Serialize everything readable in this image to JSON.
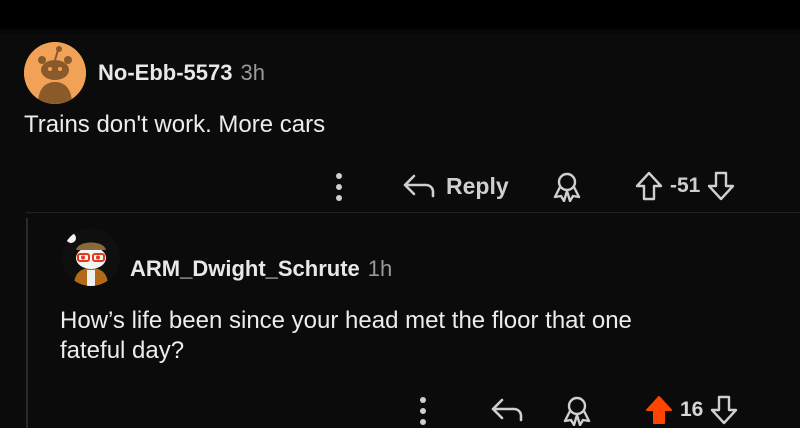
{
  "comments": [
    {
      "author": "No-Ebb-5573",
      "time": "3h",
      "body": "Trains don't work. More cars",
      "reply_label": "Reply",
      "score": "-51"
    },
    {
      "author": "ARM_Dwight_Schrute",
      "time": "1h",
      "body_line1": "How’s life been since your head met the floor that one",
      "body_line2": "fateful day?",
      "score": "16"
    }
  ],
  "colors": {
    "background": "#0b0b0b",
    "upvote_active": "#ff4500",
    "avatar_orange": "#f2a257"
  },
  "icons": [
    "more-vertical-icon",
    "reply-arrow-icon",
    "award-icon",
    "upvote-icon",
    "downvote-icon"
  ]
}
